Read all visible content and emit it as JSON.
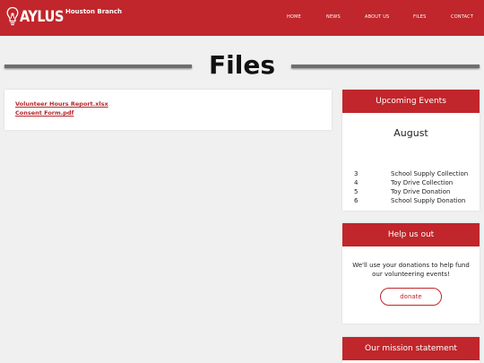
{
  "header": {
    "logo_text": "AYLUS",
    "branch": "Houston Branch",
    "nav": [
      "HOME",
      "NEWS",
      "ABOUT US",
      "FILES",
      "CONTACT"
    ]
  },
  "page_title": "Files",
  "files": [
    "Volunteer Hours Report.xlsx",
    "Consent Form.pdf"
  ],
  "events_card": {
    "title": "Upcoming Events",
    "month": "August",
    "events": [
      {
        "day": "3",
        "name": "School Supply Collection"
      },
      {
        "day": "4",
        "name": "Toy Drive Collection"
      },
      {
        "day": "5",
        "name": "Toy Drive Donation"
      },
      {
        "day": "6",
        "name": "School Supply Donation"
      }
    ]
  },
  "help_card": {
    "title": "Help us out",
    "text": "We'll use your donations to help fund our volunteering events!",
    "button": "donate"
  },
  "mission_card": {
    "title": "Our mission statement"
  },
  "colors": {
    "brand_red": "#c0262b",
    "link_red": "#b3282c",
    "page_bg": "#f0f0f0"
  }
}
